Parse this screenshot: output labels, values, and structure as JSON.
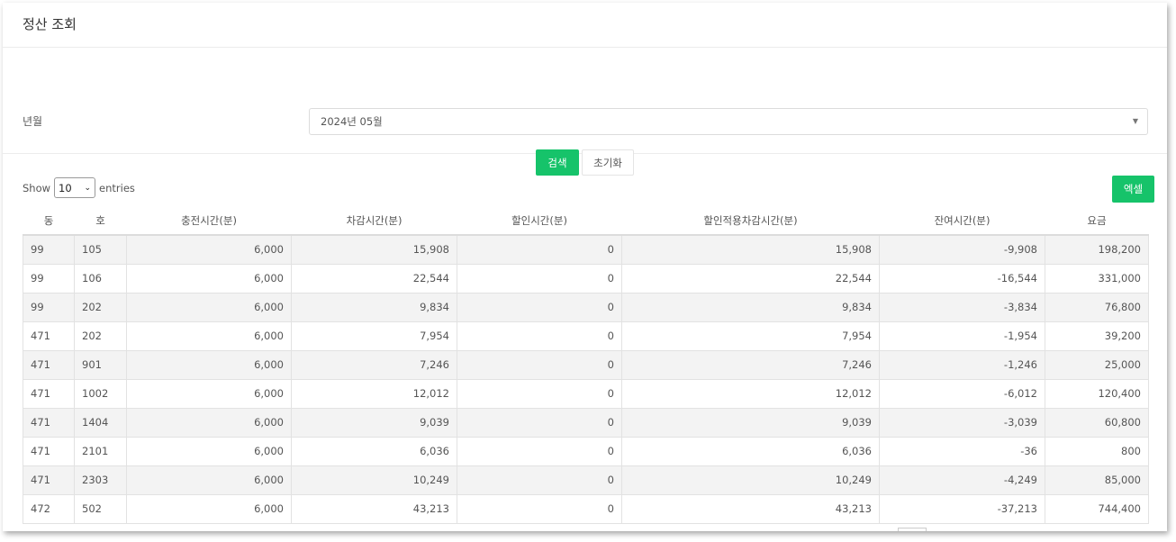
{
  "header": {
    "title": "정산 조회"
  },
  "filter": {
    "label": "년월",
    "selected": "2024년 05월",
    "arrow": "▼",
    "search_label": "검색",
    "reset_label": "초기화"
  },
  "list": {
    "show_label": "Show",
    "page_length": "10",
    "entries_label": "entries",
    "excel_label": "엑셀",
    "columns": [
      "동",
      "호",
      "충전시간(분)",
      "차감시간(분)",
      "할인시간(분)",
      "할인적용차감시간(분)",
      "잔여시간(분)",
      "요금"
    ],
    "rows": [
      [
        "99",
        "105",
        "6,000",
        "15,908",
        "0",
        "15,908",
        "-9,908",
        "198,200"
      ],
      [
        "99",
        "106",
        "6,000",
        "22,544",
        "0",
        "22,544",
        "-16,544",
        "331,000"
      ],
      [
        "99",
        "202",
        "6,000",
        "9,834",
        "0",
        "9,834",
        "-3,834",
        "76,800"
      ],
      [
        "471",
        "202",
        "6,000",
        "7,954",
        "0",
        "7,954",
        "-1,954",
        "39,200"
      ],
      [
        "471",
        "901",
        "6,000",
        "7,246",
        "0",
        "7,246",
        "-1,246",
        "25,000"
      ],
      [
        "471",
        "1002",
        "6,000",
        "12,012",
        "0",
        "12,012",
        "-6,012",
        "120,400"
      ],
      [
        "471",
        "1404",
        "6,000",
        "9,039",
        "0",
        "9,039",
        "-3,039",
        "60,800"
      ],
      [
        "471",
        "2101",
        "6,000",
        "6,036",
        "0",
        "6,036",
        "-36",
        "800"
      ],
      [
        "471",
        "2303",
        "6,000",
        "10,249",
        "0",
        "10,249",
        "-4,249",
        "85,000"
      ],
      [
        "472",
        "502",
        "6,000",
        "43,213",
        "0",
        "43,213",
        "-37,213",
        "744,400"
      ]
    ]
  },
  "colors": {
    "accent": "#16c36a",
    "stripe": "#f3f3f3"
  }
}
